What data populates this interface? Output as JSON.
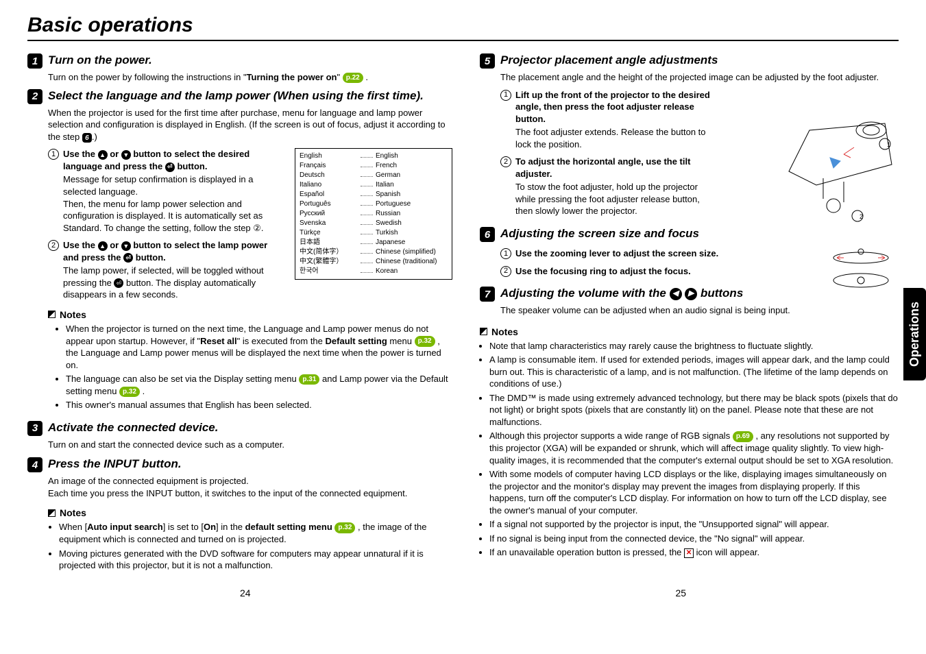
{
  "title": "Basic operations",
  "side_tab": "Operations",
  "pages": {
    "left": "24",
    "right": "25"
  },
  "left": {
    "s1": {
      "num": "1",
      "title": "Turn on the power.",
      "body_a": "Turn on the power by following the instructions in \"",
      "body_b": "Turning the power on",
      "body_c": "\" ",
      "ref": "p.22",
      "body_d": " ."
    },
    "s2": {
      "num": "2",
      "title": "Select the language and the lamp power (When using the first time).",
      "intro": "When the projector is used for the first time after purchase, menu for language and lamp power selection and configuration is displayed in English. (If the screen is out of focus, adjust it according to the step ",
      "intro_ref": "6",
      "intro_end": ".)",
      "sub1_num": "1",
      "sub1_title_a": "Use the ",
      "sub1_title_b": " or ",
      "sub1_title_c": " button to select the desired language and press the ",
      "sub1_title_d": " button.",
      "sub1_body": "Message for setup confirmation is displayed in a selected language.\nThen, the menu for lamp power selection and configuration is displayed. It is automatically set as Standard. To change the setting, follow the step ②.",
      "sub2_num": "2",
      "sub2_title_a": "Use the ",
      "sub2_title_b": " or ",
      "sub2_title_c": " button to select the lamp power and press the ",
      "sub2_title_d": " button.",
      "sub2_body": "The lamp power, if selected, will be toggled without pressing the  button. The display automatically disappears in a few seconds."
    },
    "langs": [
      {
        "n": "English",
        "e": "English"
      },
      {
        "n": "Français",
        "e": "French"
      },
      {
        "n": "Deutsch",
        "e": "German"
      },
      {
        "n": "Italiano",
        "e": "Italian"
      },
      {
        "n": "Español",
        "e": "Spanish"
      },
      {
        "n": "Português",
        "e": "Portuguese"
      },
      {
        "n": "Русский",
        "e": "Russian"
      },
      {
        "n": "Svenska",
        "e": "Swedish"
      },
      {
        "n": "Türkçe",
        "e": "Turkish"
      },
      {
        "n": "日本語",
        "e": "Japanese"
      },
      {
        "n": "中文(简体字）",
        "e": "Chinese (simplified)"
      },
      {
        "n": "中文(繁體字）",
        "e": "Chinese (traditional)"
      },
      {
        "n": "한국어",
        "e": "Korean"
      }
    ],
    "notes1_title": "Notes",
    "notes1": [
      {
        "a": "When the projector is turned on the next time, the Language and Lamp power menus do not appear upon startup. However, if \"",
        "b": "Reset all",
        "c": "\" is executed from the ",
        "d": "Default setting",
        "e": " menu ",
        "ref": "p.32",
        "f": " , the Language and Lamp power menus will be displayed the next time when the power is turned on."
      },
      {
        "a": "The language can also be set via the Display setting menu ",
        "ref1": "p.31",
        "b": " and Lamp power via the Default setting menu ",
        "ref2": "p.32",
        "c": " ."
      },
      {
        "a": "This owner's manual assumes that English has been selected."
      }
    ],
    "s3": {
      "num": "3",
      "title": "Activate the connected device.",
      "body": "Turn on and start the connected device such as a computer."
    },
    "s4": {
      "num": "4",
      "title": "Press the INPUT button.",
      "body": "An image of the connected equipment is projected.\nEach time you press the INPUT button, it switches to the input of the connected equipment."
    },
    "notes2_title": "Notes",
    "notes2": [
      {
        "a": "When [",
        "b": "Auto input search",
        "c": "] is set to [",
        "d": "On",
        "e": "] in the ",
        "f": "default setting menu ",
        "ref": "p.32",
        "g": " , the image of the equipment which is connected and turned on is projected."
      },
      {
        "a": "Moving pictures generated with the DVD software for computers may appear unnatural if it is projected with this projector, but it is not a malfunction."
      }
    ]
  },
  "right": {
    "s5": {
      "num": "5",
      "title": "Projector placement angle adjustments",
      "intro": "The placement angle and the height of the projected image can be adjusted by the foot adjuster.",
      "sub1_num": "1",
      "sub1_title": "Lift up the front of the projector to the desired angle, then press the foot adjuster release button.",
      "sub1_body": "The foot adjuster extends. Release the button to lock the position.",
      "sub2_num": "2",
      "sub2_title": "To adjust the horizontal angle, use the tilt adjuster.",
      "sub2_body": "To stow the foot adjuster, hold up the projector while pressing the foot adjuster release button, then slowly lower the projector."
    },
    "s6": {
      "num": "6",
      "title": "Adjusting the screen size and focus",
      "sub1_num": "1",
      "sub1_title": "Use the zooming lever to adjust the screen size.",
      "sub2_num": "2",
      "sub2_title": "Use the focusing ring to adjust the focus."
    },
    "s7": {
      "num": "7",
      "title_a": "Adjusting the volume with the ",
      "title_b": " buttons",
      "body": "The speaker volume can be adjusted when an audio signal is being input."
    },
    "notes_title": "Notes",
    "notes": [
      "Note that lamp characteristics may rarely cause the brightness to fluctuate slightly.",
      "A lamp is consumable item. If used for extended periods, images will appear dark, and the lamp could burn out.  This is characteristic of a lamp, and is not malfunction. (The lifetime of the lamp depends on conditions of use.)",
      "The DMD™ is made using extremely advanced technology, but there may be black spots (pixels that do not light) or bright spots (pixels that are constantly lit) on the panel.  Please note that these are not malfunctions."
    ],
    "note4_a": "Although this projector supports a wide range of RGB signals ",
    "note4_ref": "p.69",
    "note4_b": " , any resolutions not supported by this projector (XGA) will be expanded or shrunk, which will affect image quality slightly. To view high-quality images, it is recommended that the computer's external output should be set to XGA resolution.",
    "notes_more": [
      "With some models of computer having LCD displays or the like, displaying images simultaneously on the projector and the monitor's display may prevent the images from displaying properly. If this happens, turn off the computer's LCD display. For information on how to turn off the LCD display, see the owner's manual of your computer.",
      "If a signal not supported by the projector is input, the \"Unsupported signal\" will appear.",
      "If no signal is being input from the connected device, the \"No signal\" will appear."
    ],
    "note_last_a": "If an unavailable operation button is pressed, the ",
    "note_last_b": " icon will appear."
  }
}
